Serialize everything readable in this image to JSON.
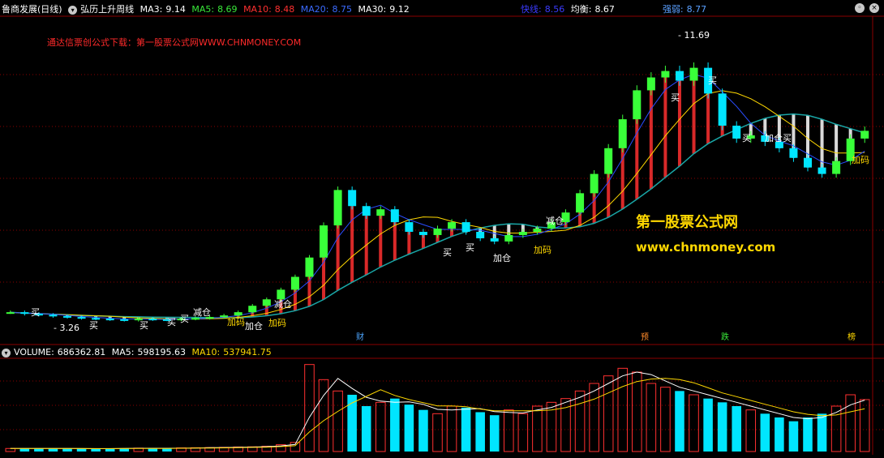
{
  "header": {
    "stock": "鲁商发展(日线)",
    "indicator": "弘历上升周线",
    "ma3": {
      "label": "MA3:",
      "value": "9.14",
      "color": "#ffffff"
    },
    "ma5": {
      "label": "MA5:",
      "value": "8.69",
      "color": "#39e839"
    },
    "ma10": {
      "label": "MA10:",
      "value": "8.48",
      "color": "#ff3030"
    },
    "ma20": {
      "label": "MA20:",
      "value": "8.75",
      "color": "#3b6bff"
    },
    "ma30": {
      "label": "MA30:",
      "value": "9.12",
      "color": "#ffffff"
    },
    "fast": {
      "label": "快线:",
      "value": "8.56",
      "color": "#3b3bff"
    },
    "balance": {
      "label": "均衡:",
      "value": "8.67",
      "color": "#ffffff"
    },
    "strength": {
      "label": "强弱:",
      "value": "8.77",
      "color": "#5aa0ff"
    }
  },
  "ad_text": "通达信票创公式下载：第一股票公式网WWW.CHNMONEY.COM",
  "watermark": {
    "line1": "第一股票公式网",
    "line2": "www.chnmoney.com"
  },
  "price_annotations": {
    "high": "11.69",
    "low": "3.26"
  },
  "signals": {
    "buy": "买",
    "reduce": "减仓",
    "add": "加码",
    "add_pos": "加仓",
    "add_buy": "加仓买"
  },
  "events": [
    {
      "label": "财",
      "color": "#4da6ff"
    },
    {
      "label": "预",
      "color": "#ff8a2a"
    },
    {
      "label": "跌",
      "color": "#39e839"
    },
    {
      "label": "榜",
      "color": "#ffd800"
    }
  ],
  "volume_header": {
    "volume": {
      "label": "VOLUME:",
      "value": "686362.81",
      "color": "#ffffff"
    },
    "ma5": {
      "label": "MA5:",
      "value": "598195.63",
      "color": "#ffffff"
    },
    "ma10": {
      "label": "MA10:",
      "value": "537941.75",
      "color": "#ffd800"
    }
  },
  "colors": {
    "up": "#ff3030",
    "down": "#00e5ff",
    "ma_white": "#ffffff",
    "ma_yellow": "#ffd800",
    "ma_teal": "#19a6a6",
    "ma_blue": "#2a4dff",
    "grid": "#8b0000"
  },
  "chart_data": {
    "type": "candlestick",
    "price_axis": {
      "min": 3.0,
      "max": 12.2
    },
    "price_series": [
      3.5,
      3.45,
      3.42,
      3.38,
      3.35,
      3.32,
      3.3,
      3.28,
      3.26,
      3.3,
      3.28,
      3.27,
      3.3,
      3.32,
      3.35,
      3.4,
      3.5,
      3.7,
      3.9,
      4.2,
      4.6,
      5.2,
      6.2,
      7.3,
      6.8,
      6.5,
      6.7,
      6.3,
      6.0,
      5.9,
      6.1,
      6.3,
      6.0,
      5.8,
      5.7,
      5.9,
      6.0,
      6.1,
      6.3,
      6.6,
      7.2,
      7.8,
      8.6,
      9.5,
      10.4,
      10.8,
      11.0,
      10.7,
      11.1,
      10.3,
      9.3,
      8.9,
      9.0,
      8.8,
      8.6,
      8.3,
      8.0,
      7.8,
      8.2,
      8.9,
      9.14
    ],
    "volume_axis": {
      "min": 0,
      "max": 1200000
    },
    "volume_series": [
      40000,
      42000,
      38000,
      41000,
      39000,
      37000,
      36000,
      40000,
      42000,
      45000,
      43000,
      41000,
      48000,
      50000,
      52000,
      55000,
      60000,
      62000,
      70000,
      90000,
      120000,
      1150000,
      950000,
      800000,
      750000,
      600000,
      650000,
      700000,
      620000,
      550000,
      500000,
      600000,
      580000,
      520000,
      480000,
      550000,
      500000,
      600000,
      650000,
      700000,
      800000,
      900000,
      1000000,
      1100000,
      1050000,
      900000,
      850000,
      800000,
      750000,
      700000,
      650000,
      600000,
      550000,
      500000,
      450000,
      400000,
      450000,
      500000,
      600000,
      750000,
      686362
    ]
  }
}
